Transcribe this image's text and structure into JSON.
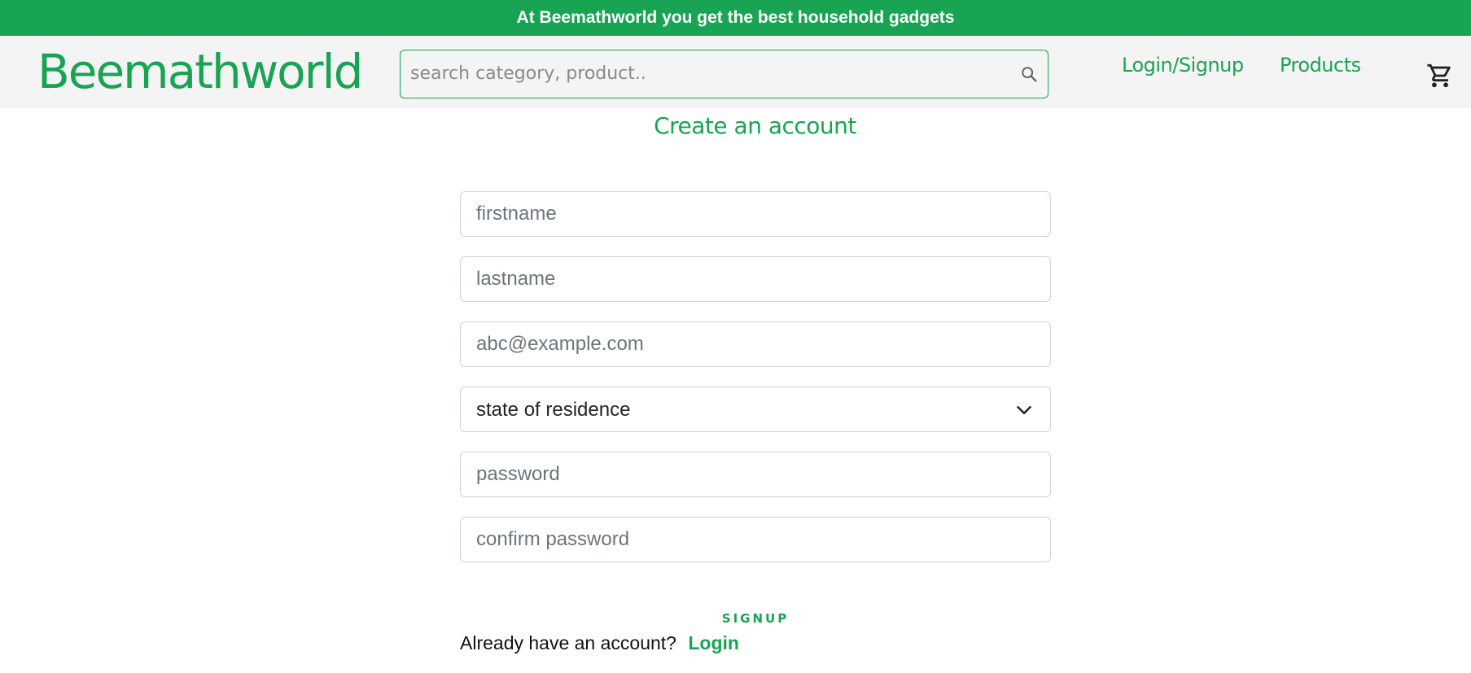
{
  "announcement": {
    "text": "At Beemathworld you get the best household gadgets"
  },
  "header": {
    "logo": "Beemathworld",
    "search": {
      "placeholder": "search category, product..",
      "value": ""
    },
    "nav": {
      "login_signup": "Login/Signup",
      "products": "Products"
    }
  },
  "main": {
    "title": "Create an account",
    "form": {
      "firstname_placeholder": "firstname",
      "lastname_placeholder": "lastname",
      "email_placeholder": "abc@example.com",
      "state_select_value": "state of residence",
      "password_placeholder": "password",
      "confirm_password_placeholder": "confirm password",
      "signup_label": "SIGNUP"
    },
    "login_prompt": {
      "text": "Already have an account?",
      "link": "Login"
    }
  },
  "colors": {
    "brand_green": "#18a452",
    "header_bg": "#f4f4f4"
  },
  "icons": {
    "search": "search-icon",
    "cart": "cart-icon",
    "select_caret": "chevron-down-icon"
  }
}
